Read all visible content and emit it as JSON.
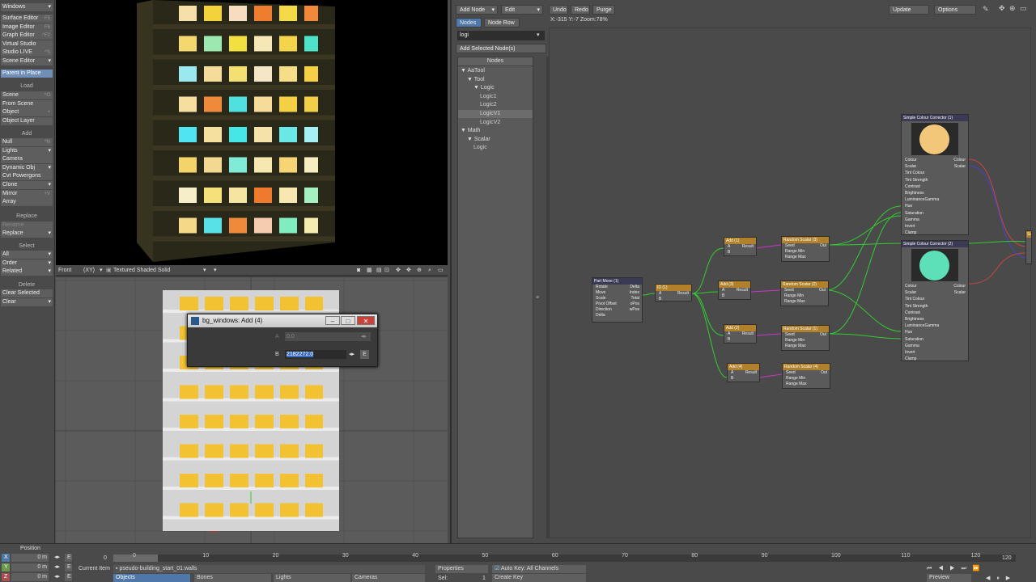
{
  "toolbar": {
    "windows": "Windows",
    "items1": [
      {
        "label": "Surface Editor",
        "key": "F5"
      },
      {
        "label": "Image Editor",
        "key": "F6"
      },
      {
        "label": "Graph Editor",
        "key": "^F2"
      },
      {
        "label": "Virtual Studio",
        "key": ""
      },
      {
        "label": "Studio LIVE",
        "key": "^S"
      },
      {
        "label": "Scene Editor",
        "key": ""
      }
    ],
    "parent_in_place": "Parent in Place",
    "load_header": "Load",
    "load_items": [
      {
        "label": "Scene",
        "key": "^O"
      },
      {
        "label": "From Scene",
        "key": ""
      },
      {
        "label": "Object",
        "key": "+"
      },
      {
        "label": "Object Layer",
        "key": ""
      }
    ],
    "add_header": "Add",
    "add_items": [
      {
        "label": "Null",
        "key": "^N"
      },
      {
        "label": "Lights",
        "key": ""
      },
      {
        "label": "Camera",
        "key": ""
      },
      {
        "label": "Dynamic Obj",
        "key": ""
      },
      {
        "label": "Cvt Powergons",
        "key": ""
      },
      {
        "label": "Clone",
        "key": ""
      },
      {
        "label": "Mirror",
        "key": "+V"
      },
      {
        "label": "Array",
        "key": ""
      }
    ],
    "replace_header": "Replace",
    "rename": "Rename",
    "replace": "Replace",
    "select_header": "Select",
    "select_items": [
      "All",
      "Order",
      "Related"
    ],
    "delete_header": "Delete",
    "delete_items": [
      "Clear Selected",
      "Clear"
    ]
  },
  "viewport": {
    "view": "Front",
    "axes": "(XY)",
    "shading": "Textured Shaded Solid"
  },
  "dialog": {
    "title": "bg_windows: Add (4)",
    "a_label": "A",
    "a_value": "0.0",
    "b_label": "B",
    "b_value": "2182272.0",
    "e_label": "E"
  },
  "node_editor": {
    "add_node": "Add Node",
    "edit": "Edit",
    "undo": "Undo",
    "redo": "Redo",
    "purge": "Purge",
    "update": "Update",
    "options": "Options",
    "tab_nodes": "Nodes",
    "tab_node_row": "Node Row",
    "coords": "X:-315 Y:-7 Zoom:78%",
    "search": "logi",
    "add_selected": "Add Selected Node(s)",
    "tree_header": "Nodes",
    "tree": [
      {
        "label": "AaTool",
        "depth": 0,
        "arrow": "▼"
      },
      {
        "label": "Tool",
        "depth": 1,
        "arrow": "▼"
      },
      {
        "label": "Logic",
        "depth": 2,
        "arrow": "▼"
      },
      {
        "label": "Logic1",
        "depth": 3,
        "arrow": ""
      },
      {
        "label": "Logic2",
        "depth": 3,
        "arrow": ""
      },
      {
        "label": "LogicV1",
        "depth": 3,
        "arrow": ""
      },
      {
        "label": "LogicV2",
        "depth": 3,
        "arrow": ""
      },
      {
        "label": "Math",
        "depth": 0,
        "arrow": "▼"
      },
      {
        "label": "Scalar",
        "depth": 1,
        "arrow": "▼"
      },
      {
        "label": "Logic",
        "depth": 2,
        "arrow": ""
      }
    ]
  },
  "nodes": {
    "part_move": {
      "title": "Part Move (1)",
      "inputs": [
        "Rotate",
        "Move",
        "Scale",
        "Pivot Offset",
        "Direction",
        "Delta"
      ],
      "outputs": [
        "Delta",
        "Index",
        "Total",
        "oPos",
        "wPos"
      ]
    },
    "id": {
      "title": "ID (1)",
      "a": "A",
      "result": "Result",
      "b": "B"
    },
    "add1": {
      "title": "Add (1)"
    },
    "add2": {
      "title": "Add (2)"
    },
    "add3": {
      "title": "Add (3)"
    },
    "add4": {
      "title": "Add (4)"
    },
    "rs1": {
      "title": "Random Scalar (1)"
    },
    "rs2": {
      "title": "Random Scalar (2)"
    },
    "rs3": {
      "title": "Random Scalar (3)"
    },
    "rs4": {
      "title": "Random Scalar (4)"
    },
    "add_ports": {
      "a": "A",
      "b": "B",
      "result": "Result"
    },
    "rs_ports": {
      "seed": "Seed",
      "out": "Out",
      "min": "Range Min",
      "max": "Range Max"
    },
    "scc1": {
      "title": "Simple Colour Corrector (1)",
      "swatch": "#f2c77a"
    },
    "scc2": {
      "title": "Simple Colour Corrector (2)",
      "swatch": "#5de0b8"
    },
    "scc_inputs": [
      "Colour",
      "Scalar",
      "Tint Colour",
      "Tint Strength",
      "Contrast",
      "Brightness",
      "LuminanceGamma",
      "Hue",
      "Saturation",
      "Gamma",
      "Invert",
      "Clamp"
    ],
    "scc_outputs": [
      "Colour",
      "Scalar"
    ],
    "sur_title": "Su"
  },
  "timeline": {
    "position": "Position",
    "x_val": "0 m",
    "y_val": "0 m",
    "z_val": "0 m",
    "x": "X",
    "y": "Y",
    "z": "Z",
    "e": "E",
    "frame_start": "0",
    "ticks": [
      "0",
      "10",
      "20",
      "30",
      "40",
      "50",
      "60",
      "70",
      "80",
      "90",
      "100",
      "110",
      "120"
    ],
    "end_frame": "120",
    "current_item_label": "Current Item",
    "current_item": "pseudo-building_start_01:walls",
    "properties": "Properties",
    "auto_key": "Auto Key: All Channels",
    "objects": "Objects",
    "bones": "Bones",
    "lights": "Lights",
    "cameras": "Cameras",
    "sel_label": "Sel:",
    "sel_value": "1",
    "create_key": "Create Key",
    "preview": "Preview"
  }
}
